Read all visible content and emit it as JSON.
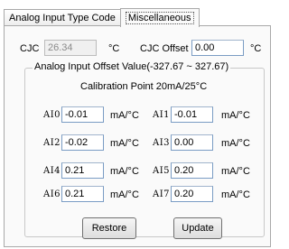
{
  "tabs": [
    {
      "label": "Analog Input Type Code",
      "active": false
    },
    {
      "label": "Miscellaneous",
      "active": true
    }
  ],
  "cjc": {
    "label": "CJC",
    "value": "26.34",
    "unit": "°C",
    "offset_label": "CJC Offset",
    "offset_value": "0.00",
    "offset_unit": "°C"
  },
  "offset_group": {
    "title": "Analog Input Offset Value(-327.67 ~ 327.67)",
    "calibration": "Calibration Point 20mA/25°C",
    "unit": "mA/°C",
    "channels": [
      {
        "label": "AI0",
        "value": "-0.01"
      },
      {
        "label": "AI1",
        "value": "-0.01"
      },
      {
        "label": "AI2",
        "value": "-0.02"
      },
      {
        "label": "AI3",
        "value": "0.00"
      },
      {
        "label": "AI4",
        "value": "0.21"
      },
      {
        "label": "AI5",
        "value": "0.20"
      },
      {
        "label": "AI6",
        "value": "0.21"
      },
      {
        "label": "AI7",
        "value": "0.20"
      }
    ]
  },
  "buttons": {
    "restore": "Restore",
    "update": "Update"
  }
}
